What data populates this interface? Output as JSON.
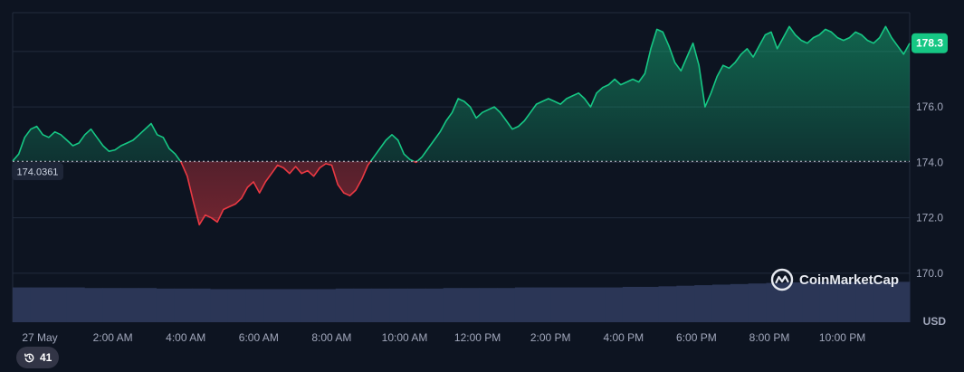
{
  "chart_data": {
    "type": "area",
    "title": "",
    "xlabel": "",
    "ylabel": "",
    "unit": "USD",
    "ylim": [
      169.9,
      179.4
    ],
    "yticks": [
      "170.0",
      "172.0",
      "174.0",
      "176.0"
    ],
    "xticks": [
      "27 May",
      "2:00 AM",
      "4:00 AM",
      "6:00 AM",
      "8:00 AM",
      "10:00 AM",
      "12:00 PM",
      "2:00 PM",
      "4:00 PM",
      "6:00 PM",
      "8:00 PM",
      "10:00 PM"
    ],
    "baseline_value": 174.0361,
    "baseline_label": "174.0361",
    "current_price_label": "178.3",
    "colors": {
      "up": "#16c784",
      "down": "#ea3943",
      "volume": "#2b3656"
    },
    "series": [
      {
        "values": [
          174.05,
          174.3,
          174.9,
          175.2,
          175.3,
          175.0,
          174.9,
          175.1,
          175.0,
          174.8,
          174.6,
          174.7,
          175.0,
          175.2,
          174.9,
          174.6,
          174.4,
          174.45,
          174.6,
          174.7,
          174.8,
          175.0,
          175.2,
          175.4,
          175.0,
          174.9,
          174.5,
          174.3,
          174.0,
          173.5,
          172.6,
          171.75,
          172.1,
          172.0,
          171.85,
          172.3,
          172.4,
          172.5,
          172.7,
          173.1,
          173.3,
          172.9,
          173.3,
          173.6,
          173.9,
          173.8,
          173.6,
          173.85,
          173.6,
          173.7,
          173.5,
          173.8,
          173.95,
          173.9,
          173.2,
          172.9,
          172.8,
          173.0,
          173.4,
          173.9,
          174.2,
          174.5,
          174.8,
          175.0,
          174.8,
          174.3,
          174.1,
          174.0,
          174.2,
          174.5,
          174.8,
          175.1,
          175.5,
          175.8,
          176.3,
          176.2,
          176.0,
          175.6,
          175.8,
          175.9,
          176.0,
          175.8,
          175.5,
          175.2,
          175.3,
          175.5,
          175.8,
          176.1,
          176.2,
          176.3,
          176.2,
          176.1,
          176.3,
          176.4,
          176.5,
          176.3,
          176.0,
          176.5,
          176.7,
          176.8,
          177.0,
          176.8,
          176.9,
          177.0,
          176.9,
          177.2,
          178.1,
          178.8,
          178.7,
          178.2,
          177.6,
          177.3,
          177.8,
          178.3,
          177.5,
          176.0,
          176.5,
          177.1,
          177.5,
          177.4,
          177.6,
          177.9,
          178.1,
          177.8,
          178.2,
          178.6,
          178.7,
          178.1,
          178.5,
          178.9,
          178.6,
          178.4,
          178.3,
          178.5,
          178.6,
          178.8,
          178.7,
          178.5,
          178.4,
          178.5,
          178.7,
          178.6,
          178.4,
          178.3,
          178.5,
          178.9,
          178.5,
          178.2,
          177.9,
          178.3
        ]
      },
      {
        "name": "",
        "values": [
          0.62,
          0.62,
          0.62,
          0.62,
          0.61,
          0.61,
          0.61,
          0.61,
          0.6,
          0.6,
          0.6,
          0.59,
          0.59,
          0.59,
          0.59,
          0.59,
          0.59,
          0.59,
          0.6,
          0.6,
          0.6,
          0.6,
          0.6,
          0.6,
          0.61,
          0.61,
          0.61,
          0.61,
          0.62,
          0.62,
          0.62,
          0.62,
          0.62,
          0.62,
          0.63,
          0.63,
          0.64,
          0.65,
          0.66,
          0.67,
          0.68,
          0.69,
          0.7,
          0.71,
          0.72,
          0.72,
          0.72,
          0.72,
          0.72,
          0.72
        ]
      }
    ]
  },
  "watermark": {
    "text": "CoinMarketCap"
  },
  "history_badge": {
    "count": "41"
  }
}
